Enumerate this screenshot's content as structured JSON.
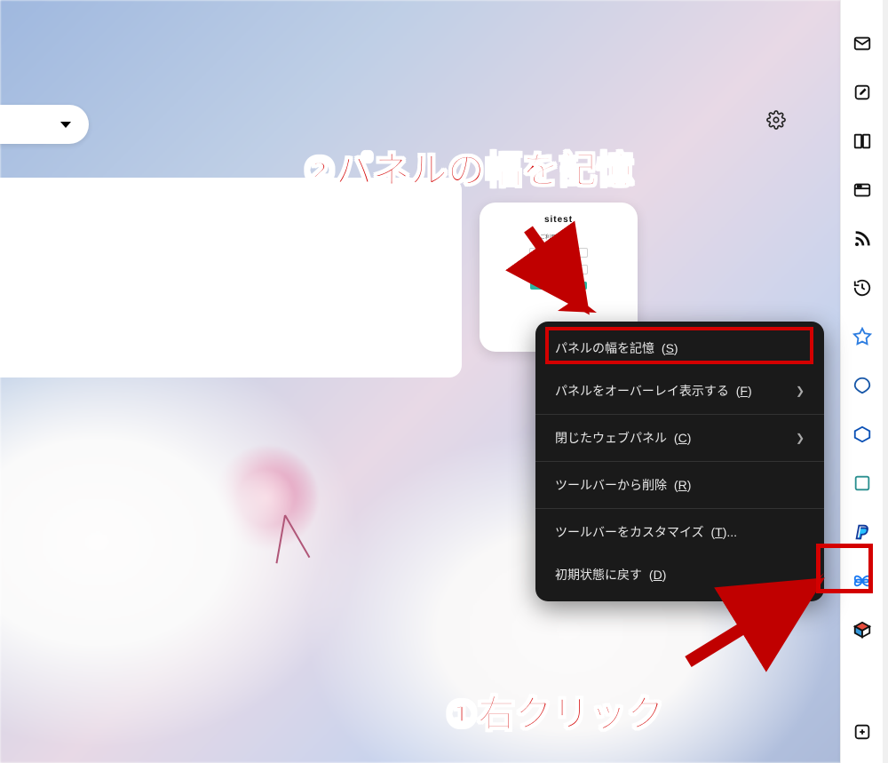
{
  "annotations": {
    "step1_marker": "①",
    "step1_text": "右クリック",
    "step2_marker": "②",
    "step2_text": "パネルの幅を記憶"
  },
  "contextMenu": {
    "items": [
      {
        "label": "パネルの幅を記憶",
        "accel": "S",
        "hasSubmenu": false
      },
      {
        "label": "パネルをオーバーレイ表示する",
        "accel": "F",
        "hasSubmenu": true
      },
      {
        "label": "閉じたウェブパネル",
        "accel": "C",
        "hasSubmenu": true
      },
      {
        "label": "ツールバーから削除",
        "accel": "R",
        "hasSubmenu": false
      },
      {
        "label": "ツールバーをカスタマイズ",
        "accel": "T",
        "suffix": "...",
        "hasSubmenu": false
      },
      {
        "label": "初期状態に戻す",
        "accel": "D",
        "hasSubmenu": false
      }
    ]
  },
  "panelPreview": {
    "brand": "sitest",
    "subtitle": "ご利用登録者様"
  },
  "sidebar": {
    "iconNames": [
      "mail-icon",
      "compose-icon",
      "reader-icon",
      "window-icon",
      "rss-icon",
      "history-icon",
      "webpanel-1-icon",
      "webpanel-2-icon",
      "webpanel-3-icon",
      "webpanel-4-icon",
      "webpanel-paypal-icon",
      "webpanel-butterfly-icon",
      "webpanel-cube-icon",
      "add-panel-icon"
    ]
  }
}
